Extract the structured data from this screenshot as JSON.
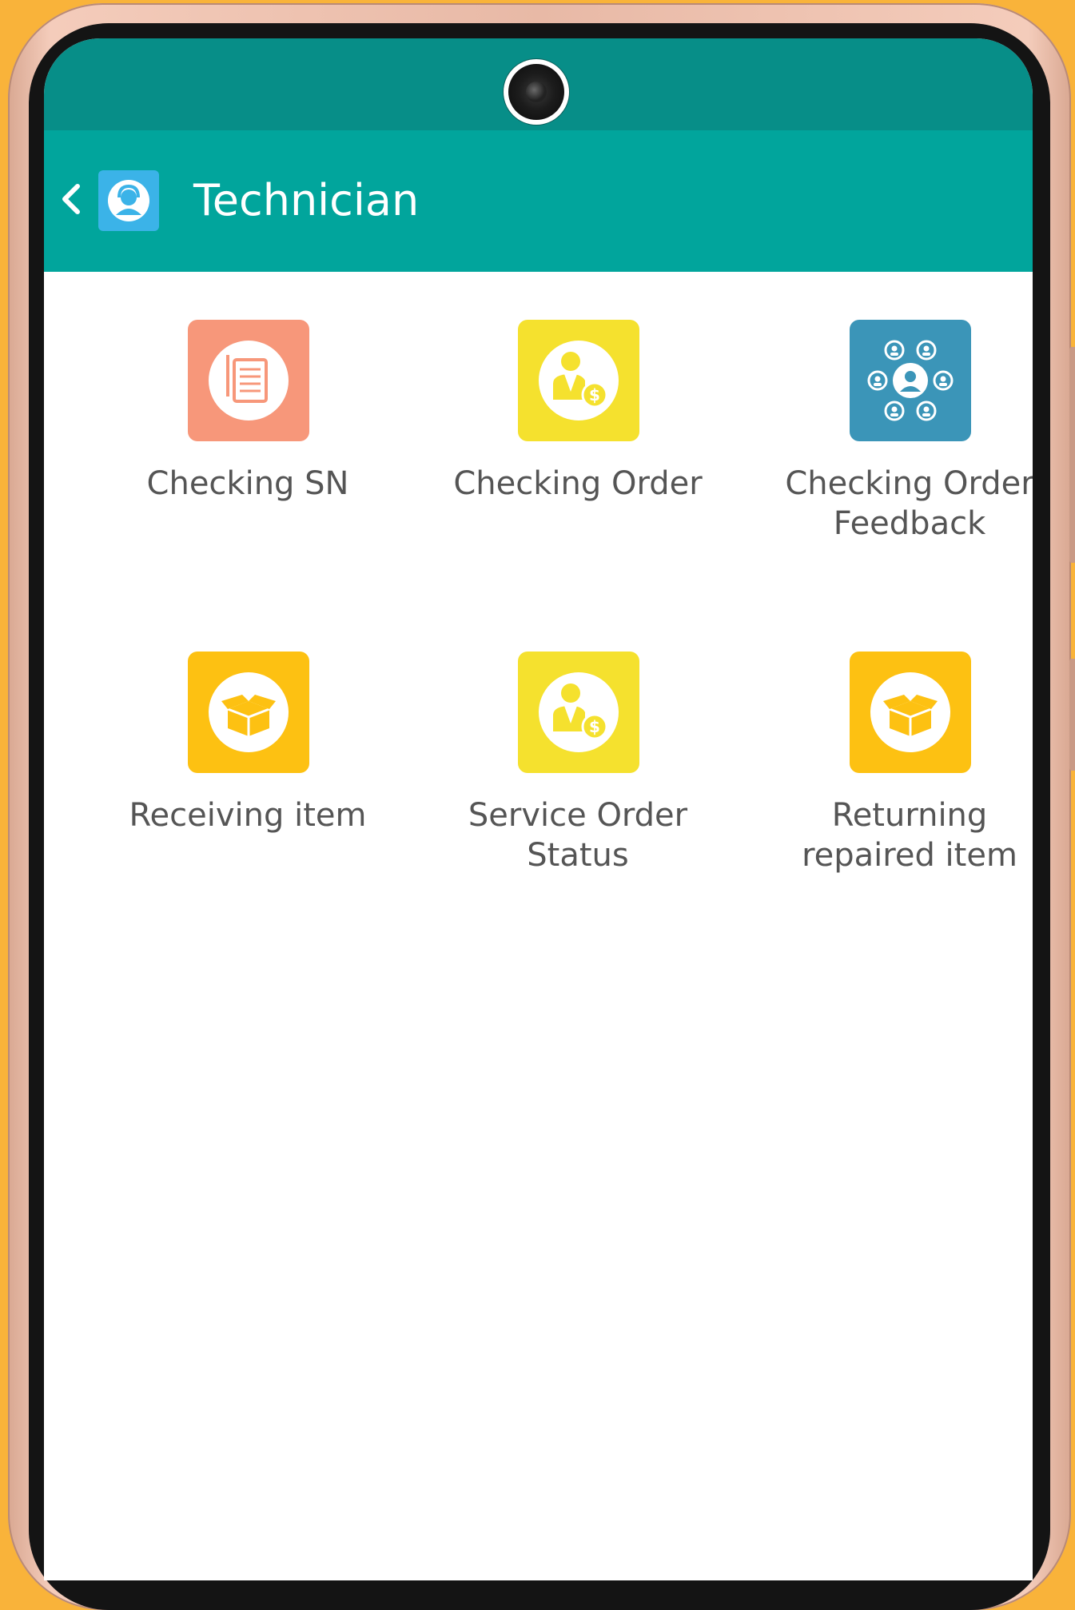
{
  "app": {
    "title": "Technician"
  },
  "menu": {
    "items": [
      {
        "label": "Checking SN",
        "color": "#f7977a",
        "icon": "document-icon"
      },
      {
        "label": "Checking Order",
        "color": "#f5e12e",
        "icon": "person-coin-icon"
      },
      {
        "label": "Checking Order\nFeedback",
        "color": "#3b95b8",
        "icon": "people-network-icon"
      },
      {
        "label": "Receiving item",
        "color": "#fdc112",
        "icon": "box-icon"
      },
      {
        "label": "Service Order\nStatus",
        "color": "#f5e12e",
        "icon": "person-coin-icon"
      },
      {
        "label": "Returning\nrepaired item",
        "color": "#fdc112",
        "icon": "box-icon"
      }
    ]
  },
  "colors": {
    "status_bar": "#078e88",
    "app_bar": "#01a59c",
    "background": "#f9b33a",
    "label_text": "#555555"
  }
}
